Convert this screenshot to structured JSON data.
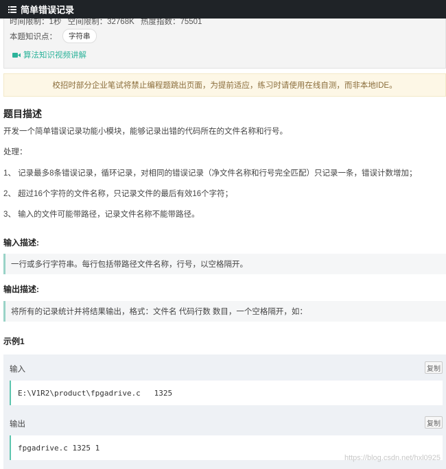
{
  "topbar": {
    "icon": "list-icon",
    "title": "简单错误记录"
  },
  "info": {
    "meta": {
      "time_limit": "时间限制：1秒",
      "space_limit": "空间限制：32768K",
      "heat": "热度指数：75501"
    },
    "knowledge_label": "本题知识点：",
    "knowledge_tag": "字符串",
    "video_link": "算法知识视频讲解",
    "video_icon": "video-camera-icon"
  },
  "notice": "校招时部分企业笔试将禁止编程题跳出页面，为提前适应，练习时请使用在线自测，而非本地IDE。",
  "description": {
    "title": "题目描述",
    "intro": "开发一个简单错误记录功能小模块，能够记录出错的代码所在的文件名称和行号。",
    "process_label": "处理：",
    "rules": [
      "1、 记录最多8条错误记录，循环记录，对相同的错误记录（净文件名称和行号完全匹配）只记录一条，错误计数增加；",
      "2、 超过16个字符的文件名称，只记录文件的最后有效16个字符；",
      "3、 输入的文件可能带路径，记录文件名称不能带路径。"
    ]
  },
  "input_desc": {
    "title": "输入描述:",
    "text": "一行或多行字符串。每行包括带路径文件名称，行号，以空格隔开。"
  },
  "output_desc": {
    "title": "输出描述:",
    "text": "将所有的记录统计并将结果输出，格式：文件名 代码行数 数目，一个空格隔开，如："
  },
  "example": {
    "title": "示例1",
    "input_label": "输入",
    "input_code": "E:\\V1R2\\product\\fpgadrive.c   1325",
    "output_label": "输出",
    "output_code": "fpgadrive.c 1325 1",
    "copy_label": "复制"
  },
  "watermark": "https://blog.csdn.net/hxl0925"
}
